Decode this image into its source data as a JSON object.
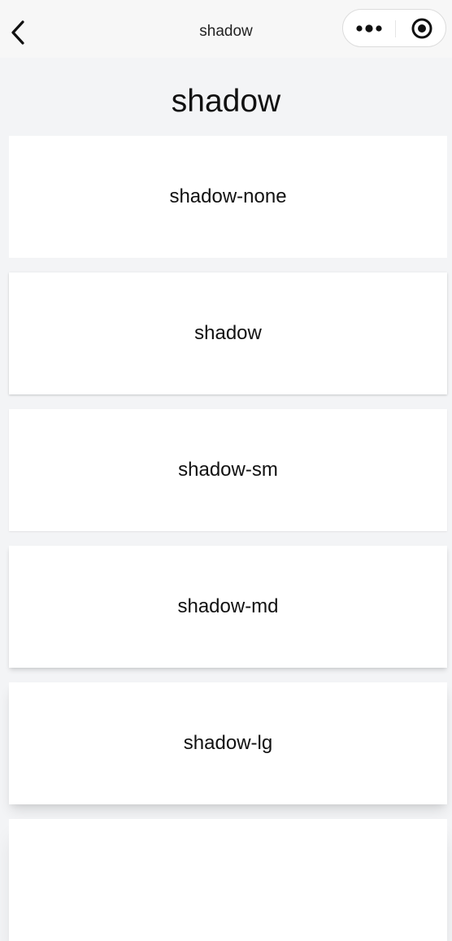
{
  "navbar": {
    "title": "shadow",
    "back_icon": "chevron-left-icon",
    "more_icon": "more-dots-icon",
    "target_icon": "target-icon"
  },
  "page": {
    "title": "shadow"
  },
  "cards": [
    {
      "label": "shadow-none"
    },
    {
      "label": "shadow"
    },
    {
      "label": "shadow-sm"
    },
    {
      "label": "shadow-md"
    },
    {
      "label": "shadow-lg"
    },
    {
      "label": ""
    }
  ],
  "colors": {
    "background": "#f3f4f6",
    "navbar": "#f7f7f7",
    "card": "#ffffff",
    "text": "#111111"
  }
}
